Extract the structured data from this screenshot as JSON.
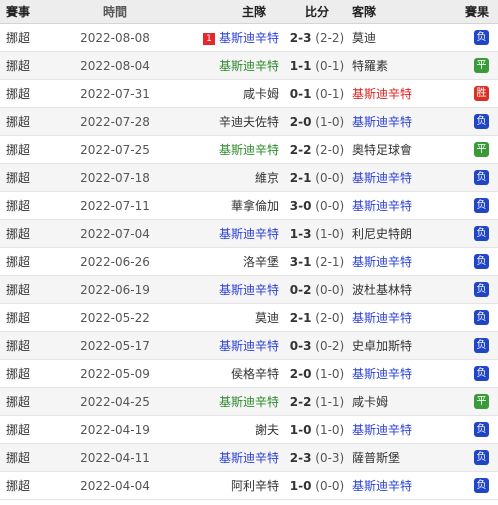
{
  "header": {
    "league": "賽事",
    "date": "時間",
    "home": "主隊",
    "score": "比分",
    "away": "客隊",
    "result": "賽果"
  },
  "focus_team": "基斯迪辛特",
  "colors": {
    "loss": "#2045c8",
    "draw": "#3a9a3a",
    "win": "#d93025",
    "red_card": "#e5262b"
  },
  "matches": [
    {
      "league": "挪超",
      "date": "2022-08-08",
      "home": "基斯迪辛特",
      "home_card": "1",
      "score": "2-3",
      "half": "(2-2)",
      "away": "莫迪",
      "result": "负"
    },
    {
      "league": "挪超",
      "date": "2022-08-04",
      "home": "基斯迪辛特",
      "home_card": "",
      "score": "1-1",
      "half": "(0-1)",
      "away": "特羅素",
      "result": "平"
    },
    {
      "league": "挪超",
      "date": "2022-07-31",
      "home": "咸卡姆",
      "home_card": "",
      "score": "0-1",
      "half": "(0-1)",
      "away": "基斯迪辛特",
      "result": "胜"
    },
    {
      "league": "挪超",
      "date": "2022-07-28",
      "home": "辛迪夫佐特",
      "home_card": "",
      "score": "2-0",
      "half": "(1-0)",
      "away": "基斯迪辛特",
      "result": "负"
    },
    {
      "league": "挪超",
      "date": "2022-07-25",
      "home": "基斯迪辛特",
      "home_card": "",
      "score": "2-2",
      "half": "(2-0)",
      "away": "奧特足球會",
      "result": "平"
    },
    {
      "league": "挪超",
      "date": "2022-07-18",
      "home": "維京",
      "home_card": "",
      "score": "2-1",
      "half": "(0-0)",
      "away": "基斯迪辛特",
      "result": "负"
    },
    {
      "league": "挪超",
      "date": "2022-07-11",
      "home": "華拿倫加",
      "home_card": "",
      "score": "3-0",
      "half": "(0-0)",
      "away": "基斯迪辛特",
      "result": "负"
    },
    {
      "league": "挪超",
      "date": "2022-07-04",
      "home": "基斯迪辛特",
      "home_card": "",
      "score": "1-3",
      "half": "(1-0)",
      "away": "利尼史特朗",
      "result": "负"
    },
    {
      "league": "挪超",
      "date": "2022-06-26",
      "home": "洛辛堡",
      "home_card": "",
      "score": "3-1",
      "half": "(2-1)",
      "away": "基斯迪辛特",
      "result": "负"
    },
    {
      "league": "挪超",
      "date": "2022-06-19",
      "home": "基斯迪辛特",
      "home_card": "",
      "score": "0-2",
      "half": "(0-0)",
      "away": "波杜基林特",
      "result": "负"
    },
    {
      "league": "挪超",
      "date": "2022-05-22",
      "home": "莫迪",
      "home_card": "",
      "score": "2-1",
      "half": "(2-0)",
      "away": "基斯迪辛特",
      "result": "负"
    },
    {
      "league": "挪超",
      "date": "2022-05-17",
      "home": "基斯迪辛特",
      "home_card": "",
      "score": "0-3",
      "half": "(0-2)",
      "away": "史卓加斯特",
      "result": "负"
    },
    {
      "league": "挪超",
      "date": "2022-05-09",
      "home": "侯格辛特",
      "home_card": "",
      "score": "2-0",
      "half": "(1-0)",
      "away": "基斯迪辛特",
      "result": "负"
    },
    {
      "league": "挪超",
      "date": "2022-04-25",
      "home": "基斯迪辛特",
      "home_card": "",
      "score": "2-2",
      "half": "(1-1)",
      "away": "咸卡姆",
      "result": "平"
    },
    {
      "league": "挪超",
      "date": "2022-04-19",
      "home": "謝夫",
      "home_card": "",
      "score": "1-0",
      "half": "(1-0)",
      "away": "基斯迪辛特",
      "result": "负"
    },
    {
      "league": "挪超",
      "date": "2022-04-11",
      "home": "基斯迪辛特",
      "home_card": "",
      "score": "2-3",
      "half": "(0-3)",
      "away": "薩普斯堡",
      "result": "负"
    },
    {
      "league": "挪超",
      "date": "2022-04-04",
      "home": "阿利辛特",
      "home_card": "",
      "score": "1-0",
      "half": "(0-0)",
      "away": "基斯迪辛特",
      "result": "负"
    }
  ]
}
